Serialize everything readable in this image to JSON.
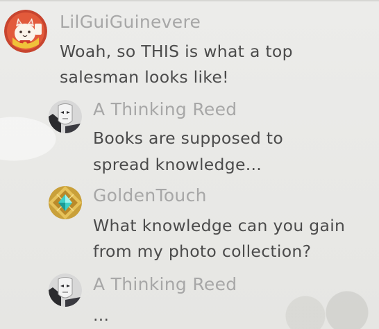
{
  "chat": {
    "messages": [
      {
        "author": "LilGuiGuinevere",
        "avatar_icon": "lucky-cat-avatar-icon",
        "lines": [
          "Woah, so THIS is what a top",
          "salesman looks like!"
        ]
      },
      {
        "author": "A Thinking Reed",
        "avatar_icon": "masked-figure-avatar-icon",
        "lines": [
          "Books are supposed to",
          "spread knowledge..."
        ]
      },
      {
        "author": "GoldenTouch",
        "avatar_icon": "gold-gem-avatar-icon",
        "lines": [
          "What knowledge can you gain",
          "from my photo collection?"
        ]
      },
      {
        "author": "A Thinking Reed",
        "avatar_icon": "masked-figure-avatar-icon",
        "lines": [
          "..."
        ]
      }
    ]
  },
  "colors": {
    "background": "#e9e9e7",
    "author_name": "#a7a7a7",
    "message_text": "#4b4b4b"
  }
}
